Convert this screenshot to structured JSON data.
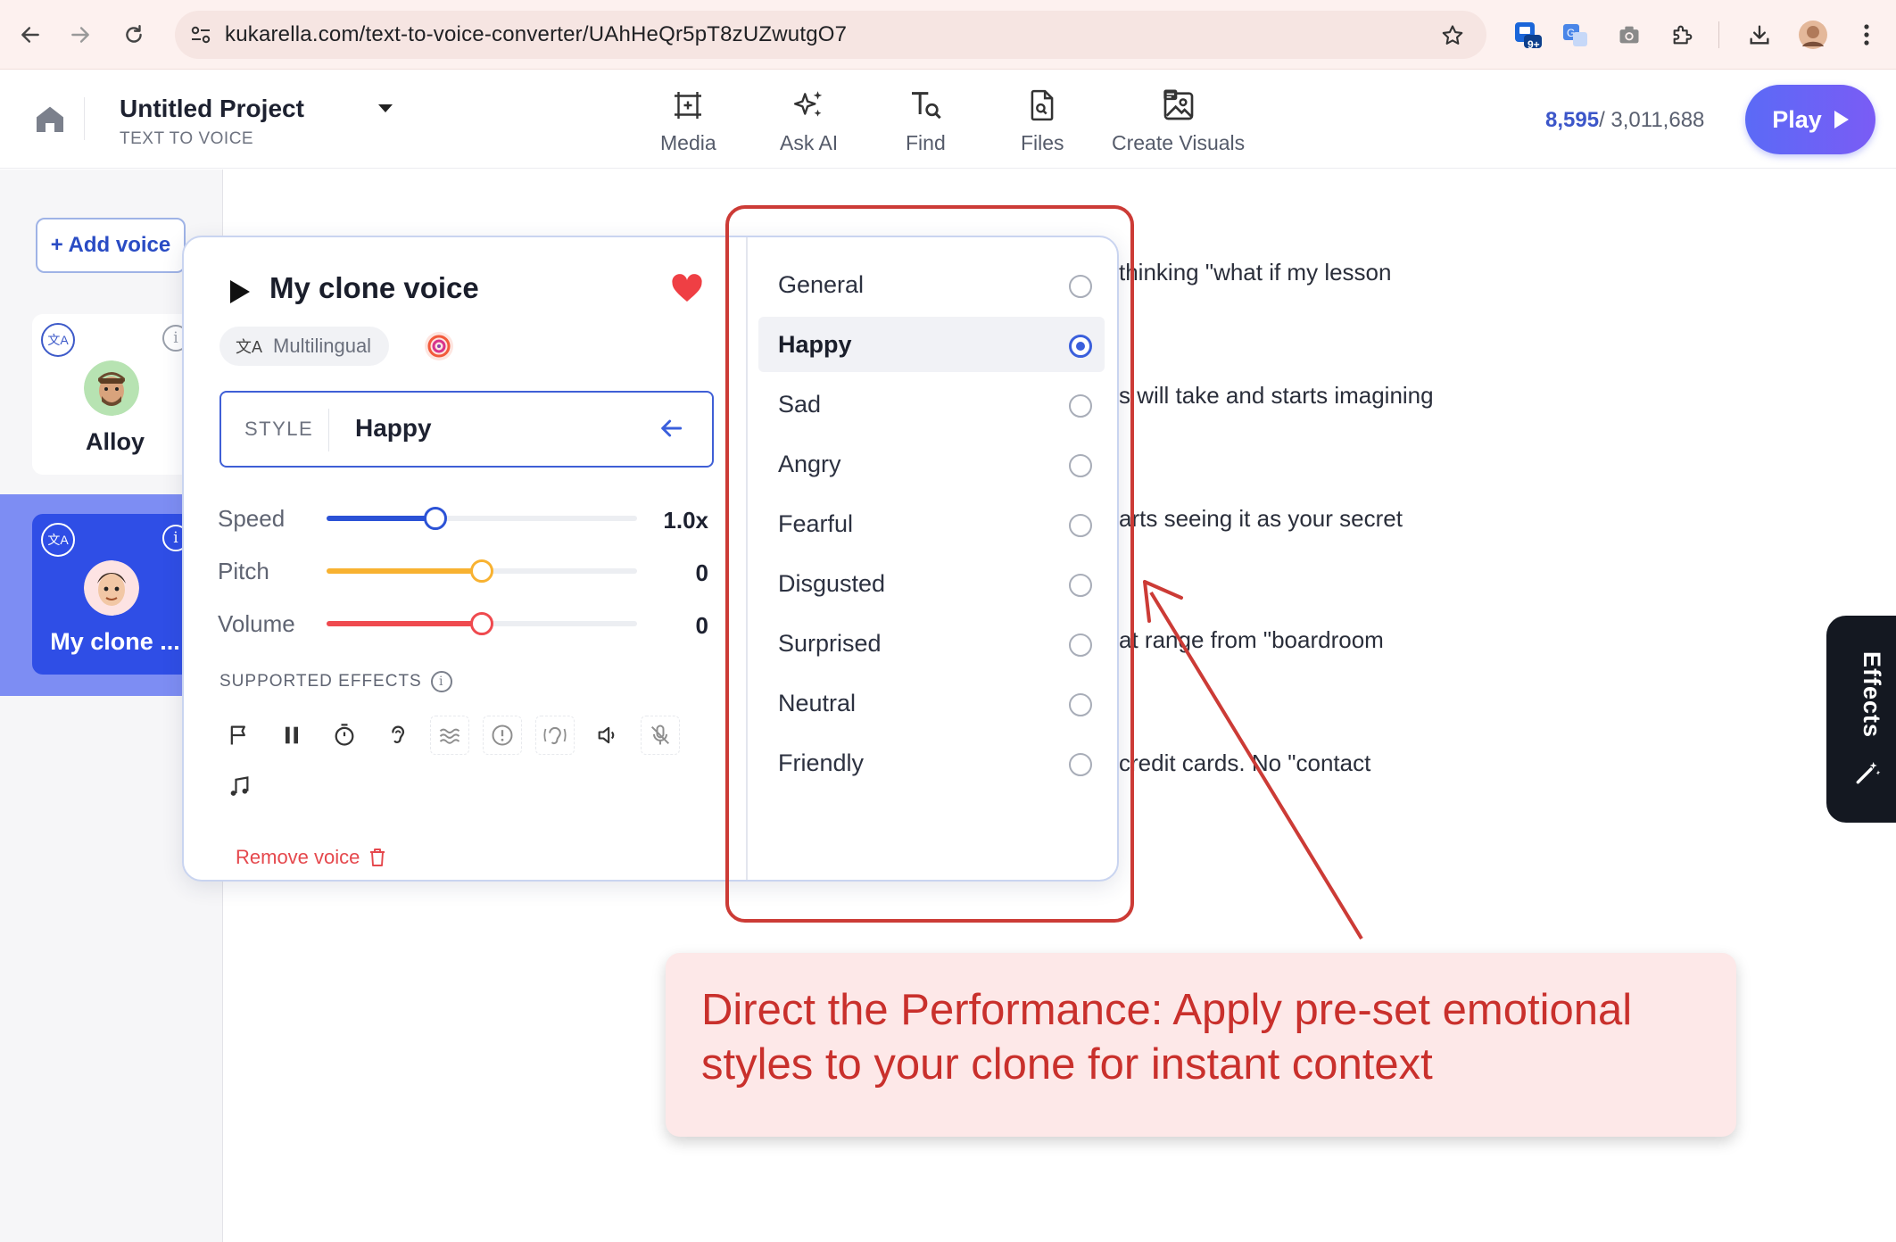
{
  "browser": {
    "url": "kukarella.com/text-to-voice-converter/UAhHeQr5pT8zUZwutgO7",
    "ext_badge": "9+"
  },
  "header": {
    "project_title": "Untitled Project",
    "project_subtitle": "TEXT TO VOICE",
    "tools": [
      {
        "label": "Media",
        "icon": "media-frame-icon"
      },
      {
        "label": "Ask AI",
        "icon": "sparkles-icon"
      },
      {
        "label": "Find",
        "icon": "find-text-icon"
      },
      {
        "label": "Files",
        "icon": "file-search-icon"
      },
      {
        "label": "Create Visuals",
        "icon": "image-create-icon"
      }
    ],
    "credits_used": "8,595",
    "credits_total": "/ 3,011,688",
    "play_label": "Play"
  },
  "sidebar": {
    "add_voice_label": "+ Add voice",
    "voices": [
      {
        "name": "Alloy",
        "selected": false
      },
      {
        "name": "My clone ...",
        "selected": true
      }
    ]
  },
  "voice_panel": {
    "title": "My clone voice",
    "favorite": true,
    "language_badge": "Multilingual",
    "style_key": "STYLE",
    "style_value": "Happy",
    "sliders": [
      {
        "label": "Speed",
        "value_text": "1.0x",
        "fraction": 0.35,
        "color": "#2b52d6"
      },
      {
        "label": "Pitch",
        "value_text": "0",
        "fraction": 0.5,
        "color": "#f8b231"
      },
      {
        "label": "Volume",
        "value_text": "0",
        "fraction": 0.5,
        "color": "#ef4a4f"
      }
    ],
    "effects_title": "SUPPORTED EFFECTS",
    "effects": [
      {
        "icon": "flag-icon",
        "enabled": true
      },
      {
        "icon": "pause-icon",
        "enabled": true
      },
      {
        "icon": "stopwatch-icon",
        "enabled": true
      },
      {
        "icon": "ear-icon",
        "enabled": true
      },
      {
        "icon": "waves-icon",
        "enabled": false
      },
      {
        "icon": "emphasis-icon",
        "enabled": false
      },
      {
        "icon": "whisper-icon",
        "enabled": false
      },
      {
        "icon": "volume-icon",
        "enabled": true
      },
      {
        "icon": "mute-mic-icon",
        "enabled": false
      },
      {
        "icon": "music-note-icon",
        "enabled": true
      }
    ],
    "remove_voice_label": "Remove voice",
    "styles": [
      {
        "label": "General",
        "selected": false
      },
      {
        "label": "Happy",
        "selected": true
      },
      {
        "label": "Sad",
        "selected": false
      },
      {
        "label": "Angry",
        "selected": false
      },
      {
        "label": "Fearful",
        "selected": false
      },
      {
        "label": "Disgusted",
        "selected": false
      },
      {
        "label": "Surprised",
        "selected": false
      },
      {
        "label": "Neutral",
        "selected": false
      },
      {
        "label": "Friendly",
        "selected": false
      }
    ]
  },
  "editor": {
    "lines": [
      "thinking \"what if my lesson",
      "s will take and starts imagining",
      "arts seeing it as your secret",
      "at range from \"boardroom",
      "credit cards. No \"contact"
    ]
  },
  "annotation": {
    "callout_text": "Direct the Performance: Apply pre-set emotional styles to your clone for instant context",
    "accent_color": "#cc3b36"
  },
  "effects_tab": {
    "label": "Effects"
  }
}
